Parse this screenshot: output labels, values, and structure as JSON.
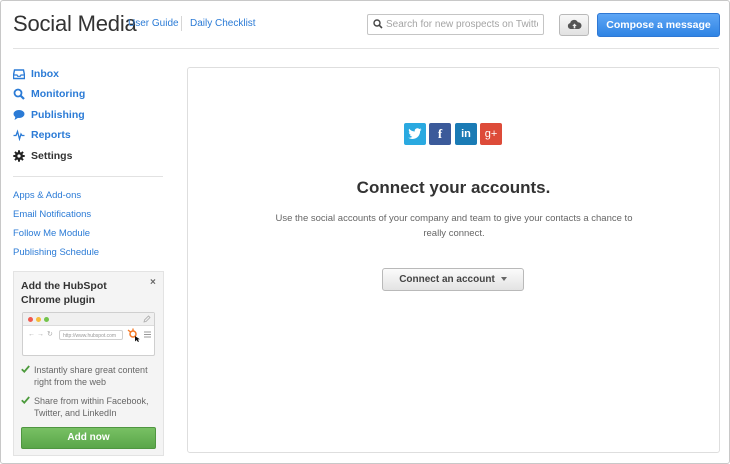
{
  "header": {
    "title": "Social Media",
    "links": {
      "user_guide": "User Guide",
      "daily_checklist": "Daily Checklist"
    },
    "search": {
      "placeholder": "Search for new prospects on Twitter",
      "value": ""
    },
    "compose_label": "Compose a message"
  },
  "sidebar": {
    "nav": [
      {
        "label": "Inbox",
        "icon": "inbox-icon",
        "active": false
      },
      {
        "label": "Monitoring",
        "icon": "search-icon",
        "active": false
      },
      {
        "label": "Publishing",
        "icon": "speech-bubble-icon",
        "active": false
      },
      {
        "label": "Reports",
        "icon": "pulse-icon",
        "active": false
      },
      {
        "label": "Settings",
        "icon": "gear-icon",
        "active": true
      }
    ],
    "links": [
      {
        "label": "Apps & Add-ons"
      },
      {
        "label": "Email Notifications"
      },
      {
        "label": "Follow Me Module"
      },
      {
        "label": "Publishing Schedule"
      }
    ]
  },
  "promo": {
    "title": "Add the HubSpot Chrome plugin",
    "close": "×",
    "mock_url": "http://www.hubspot.com",
    "bullets": [
      {
        "text": "Instantly share great content right from the web"
      },
      {
        "text": "Share from within Facebook, Twitter, and LinkedIn"
      }
    ],
    "add_label": "Add now"
  },
  "main": {
    "social": [
      {
        "name": "twitter",
        "glyph": "",
        "color": "#2aa9e0"
      },
      {
        "name": "facebook",
        "glyph": "f",
        "color": "#3b5a9a"
      },
      {
        "name": "linkedin",
        "glyph": "in",
        "color": "#1a7bb5"
      },
      {
        "name": "google-plus",
        "glyph": "g+",
        "color": "#dd4b39"
      }
    ],
    "title": "Connect your accounts.",
    "description": "Use the social accounts of your company and team to give your contacts a chance to really connect.",
    "connect_label": "Connect an account"
  },
  "colors": {
    "link": "#2b7bd6",
    "compose": "#3a8ae8",
    "add": "#66b152"
  }
}
